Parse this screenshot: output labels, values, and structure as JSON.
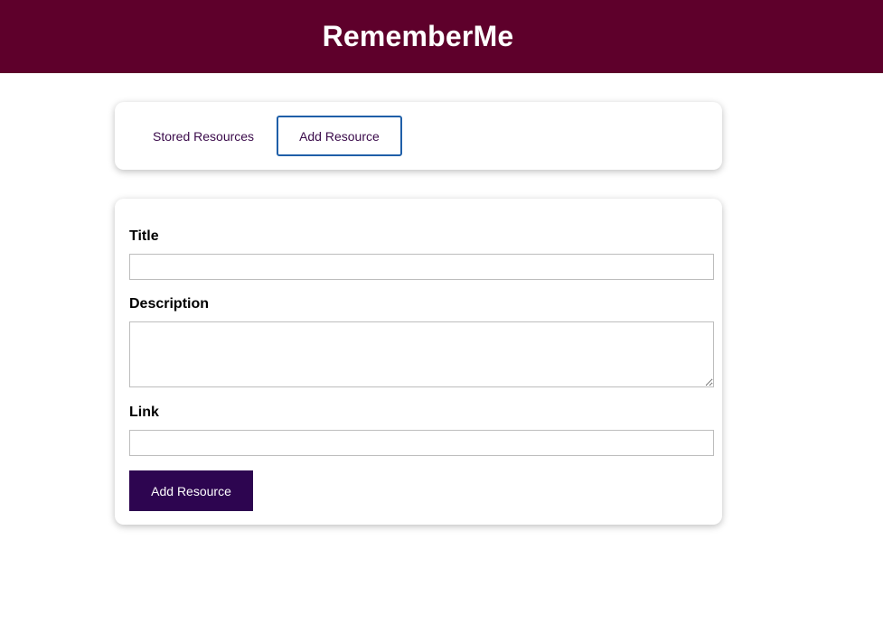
{
  "header": {
    "title": "RememberMe"
  },
  "nav": {
    "tabs": [
      {
        "label": "Stored Resources",
        "active": false
      },
      {
        "label": "Add Resource",
        "active": true
      }
    ]
  },
  "form": {
    "title_label": "Title",
    "title_value": "",
    "description_label": "Description",
    "description_value": "",
    "link_label": "Link",
    "link_value": "",
    "submit_label": "Add Resource"
  },
  "colors": {
    "header_bg": "#5e002b",
    "active_tab_border": "#1f5fa8",
    "button_bg": "#2d0550",
    "tab_text": "#3a0a4a"
  }
}
